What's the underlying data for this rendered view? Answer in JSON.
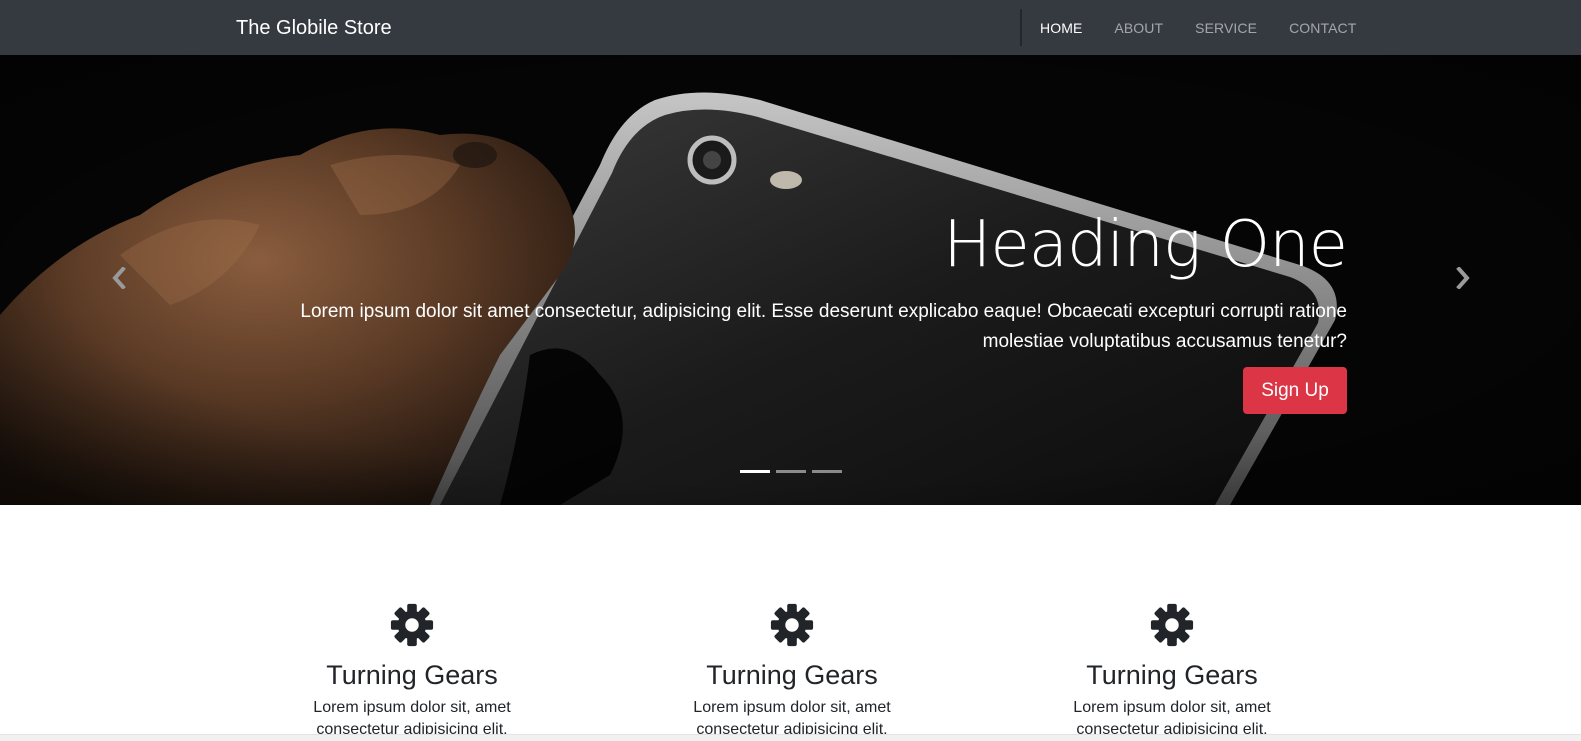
{
  "navbar": {
    "brand": "The Globile Store",
    "links": [
      {
        "label": "HOME",
        "active": true
      },
      {
        "label": "ABOUT",
        "active": false
      },
      {
        "label": "SERVICE",
        "active": false
      },
      {
        "label": "CONTACT",
        "active": false
      }
    ]
  },
  "carousel": {
    "heading": "Heading One",
    "text": "Lorem ipsum dolor sit amet consectetur, adipisicing elit. Esse deserunt explicabo eaque! Obcaecati excepturi corrupti ratione molestiae voluptatibus accusamus tenetur?",
    "button_label": "Sign Up",
    "prev_icon": "chevron-left-icon",
    "next_icon": "chevron-right-icon",
    "indicators": [
      true,
      false,
      false
    ]
  },
  "features": [
    {
      "icon": "gear-icon",
      "title": "Turning Gears",
      "text": "Lorem ipsum dolor sit, amet consectetur adipisicing elit."
    },
    {
      "icon": "gear-icon",
      "title": "Turning Gears",
      "text": "Lorem ipsum dolor sit, amet consectetur adipisicing elit."
    },
    {
      "icon": "gear-icon",
      "title": "Turning Gears",
      "text": "Lorem ipsum dolor sit, amet consectetur adipisicing elit."
    }
  ],
  "colors": {
    "navbar": "#343a40",
    "button": "#dc3545",
    "text": "#212529"
  }
}
